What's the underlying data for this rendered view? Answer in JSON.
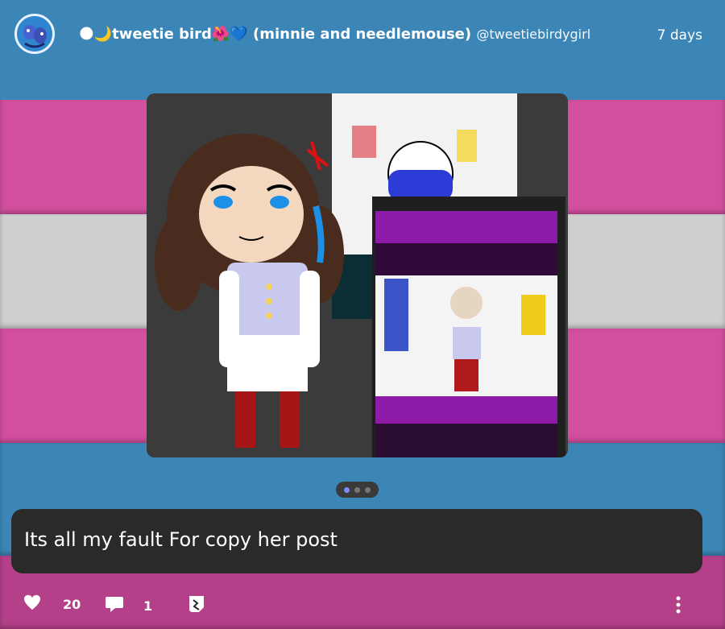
{
  "post": {
    "author_name": "🌑🌙tweetie bird🌺💙 (minnie and needlemouse)",
    "author_handle": "@tweetiebirdygirl",
    "time_ago": "7 days",
    "caption": "Its all my fault For copy her post",
    "likes": "20",
    "comments": "1"
  },
  "media": {
    "pages": 3,
    "active_page": 1
  },
  "icons": {
    "like": "heart-icon",
    "comment": "speech-bubble-icon",
    "reblog": "reblog-icon",
    "more": "vertical-ellipsis-icon"
  },
  "colors": {
    "blue": "#3b86b6",
    "pink": "#d24f9f",
    "caption_bg": "#2b2a29",
    "active_dot": "#7b8cff"
  }
}
